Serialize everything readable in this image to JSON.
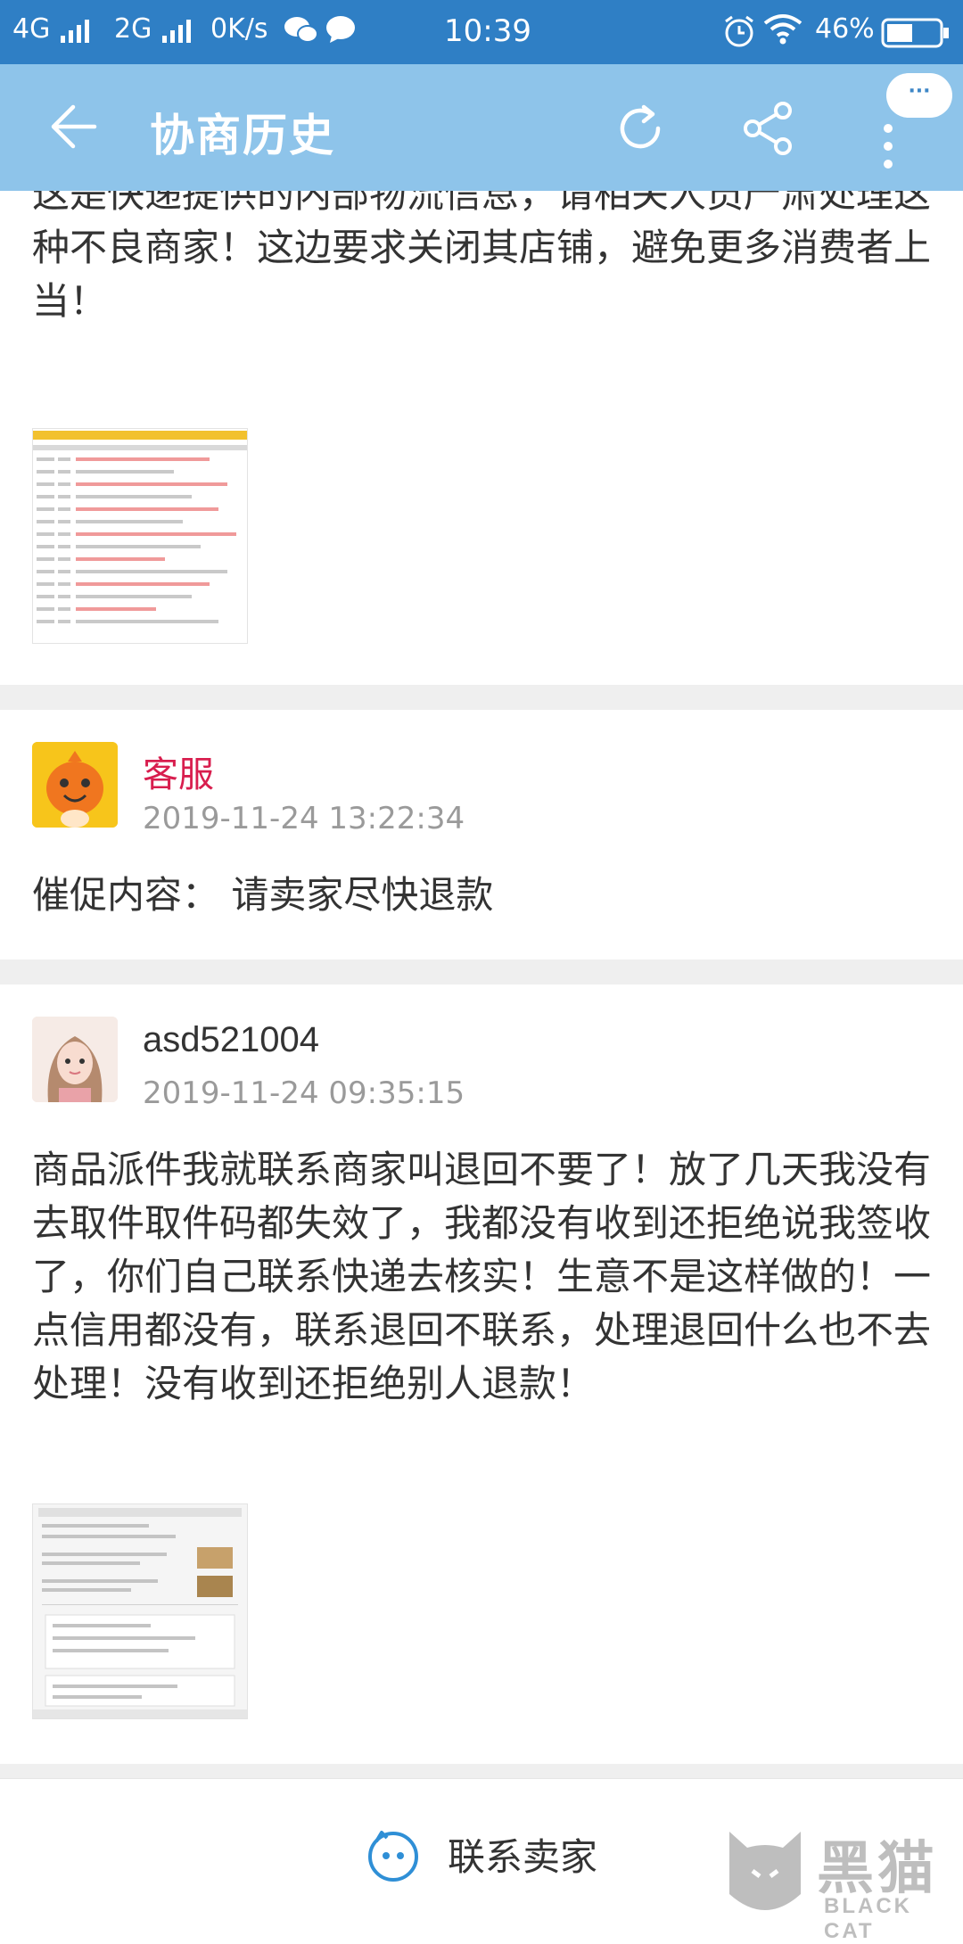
{
  "status_bar": {
    "network1": "4G",
    "network2": "2G",
    "speed": "0K/s",
    "time": "10:39",
    "battery": "46%"
  },
  "header": {
    "title": "协商历史",
    "bubble": "···"
  },
  "messages": [
    {
      "text": "这是快递提供的内部物流信息，请相关人员严肃处理这种不良商家！这边要求关闭其店铺，避免更多消费者上当！"
    },
    {
      "name": "客服",
      "time": "2019-11-24 13:22:34",
      "text": "催促内容：  请卖家尽快退款"
    },
    {
      "name": "asd521004",
      "time": "2019-11-24 09:35:15",
      "text": "商品派件我就联系商家叫退回不要了！放了几天我没有去取件取件码都失效了，我都没有收到还拒绝说我签收了，你们自己联系快递去核实！生意不是这样做的！一点信用都没有，联系退回不联系，处理退回什么也不去处理！没有收到还拒绝别人退款！"
    }
  ],
  "bottom": {
    "contact_label": "联系卖家"
  },
  "watermark": {
    "cn": "黑猫",
    "en": "BLACK CAT"
  },
  "colors": {
    "statusbar": "#2f7fc5",
    "titlebar": "#8ec4ea",
    "service_name": "#d81e4e",
    "timestamp": "#9a9a9a"
  }
}
